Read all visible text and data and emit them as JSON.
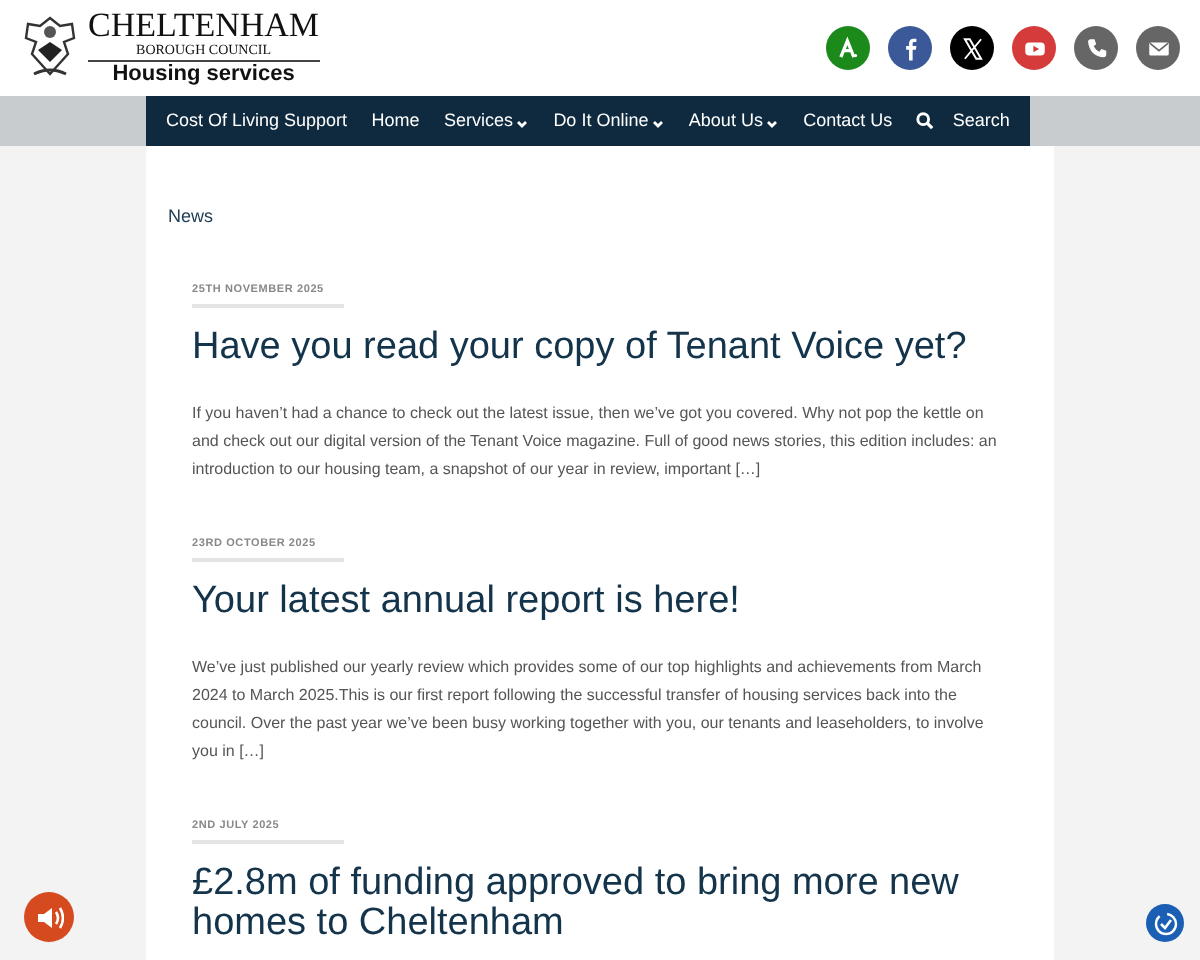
{
  "logo": {
    "name": "CHELTENHAM",
    "council": "BOROUGH COUNCIL",
    "site": "Housing services"
  },
  "social": [
    {
      "kind": "accessibility"
    },
    {
      "kind": "facebook"
    },
    {
      "kind": "x"
    },
    {
      "kind": "youtube"
    },
    {
      "kind": "phone"
    },
    {
      "kind": "email"
    }
  ],
  "nav": [
    {
      "label": "Cost Of Living Support",
      "dropdown": false
    },
    {
      "label": "Home",
      "dropdown": false
    },
    {
      "label": "Services",
      "dropdown": true
    },
    {
      "label": "Do It Online",
      "dropdown": true
    },
    {
      "label": "About Us",
      "dropdown": true
    },
    {
      "label": "Contact Us",
      "dropdown": false
    },
    {
      "label": "Search",
      "kind": "search",
      "dropdown": false
    }
  ],
  "breadcrumb": "News",
  "articles": [
    {
      "date": "25TH NOVEMBER 2025",
      "title": "Have you read your copy of Tenant Voice yet?",
      "excerpt": "If you haven’t had a chance to check out the latest issue, then we’ve got you covered. Why not pop the kettle on and check out our digital version of the Tenant Voice magazine. Full of good news stories, this edition includes: an introduction to our housing team, a snapshot of our year in review, important […]"
    },
    {
      "date": "23RD OCTOBER 2025",
      "title": "Your latest annual report is here!",
      "excerpt": "We’ve just published our yearly review which provides some of our top highlights and achievements from March 2024 to March 2025.This is our first report following the successful transfer of housing services back into the council. Over the past year we’ve been busy working together with you, our tenants and leaseholders, to involve you in […]"
    },
    {
      "date": "2ND JULY 2025",
      "title": "£2.8m of funding approved to bring more new homes to Cheltenham"
    }
  ]
}
